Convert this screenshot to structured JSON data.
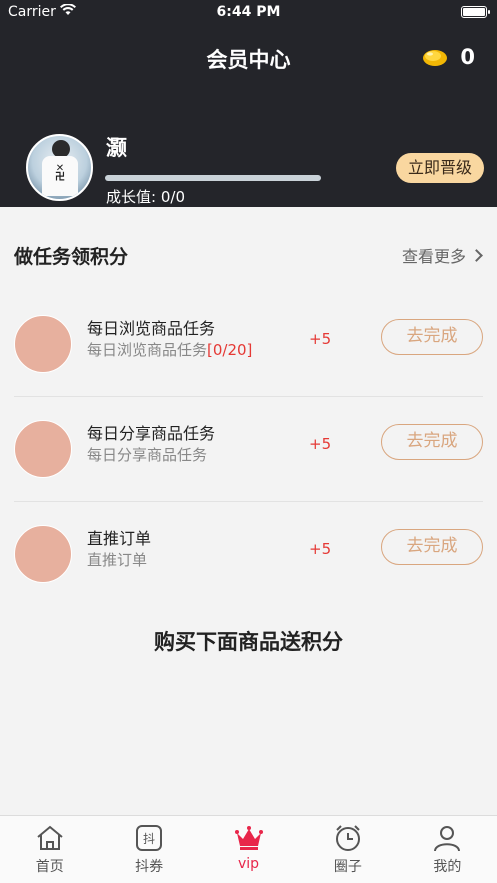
{
  "status_bar": {
    "carrier": "Carrier",
    "time": "6:44 PM"
  },
  "header": {
    "title": "会员中心",
    "coins": "0"
  },
  "profile": {
    "username": "灏",
    "growth_label": "成长值:",
    "growth_value": "0/0",
    "growth_progress": 0,
    "upgrade_label": "立即晋级"
  },
  "tasks_section": {
    "title": "做任务领积分",
    "more_label": "查看更多",
    "tasks": [
      {
        "name": "每日浏览商品任务",
        "sub": "每日浏览商品任务",
        "sub_highlight": "[0/20]",
        "points": "+5",
        "button": "去完成"
      },
      {
        "name": "每日分享商品任务",
        "sub": "每日分享商品任务",
        "points": "+5",
        "button": "去完成"
      },
      {
        "name": "直推订单",
        "sub": "直推订单",
        "points": "+5",
        "button": "去完成"
      }
    ]
  },
  "promo_title": "购买下面商品送积分",
  "tabbar": {
    "active_index": 2,
    "tabs": [
      {
        "label": "首页",
        "icon": "home-icon"
      },
      {
        "label": "抖券",
        "icon": "douquan-icon"
      },
      {
        "label": "vip",
        "icon": "crown-icon"
      },
      {
        "label": "圈子",
        "icon": "alarm-clock-icon"
      },
      {
        "label": "我的",
        "icon": "user-icon"
      }
    ]
  },
  "colors": {
    "header_bg": "#24252a",
    "accent_gold": "#f9d7a0",
    "accent_red": "#e53935",
    "vip_pink": "#e8264a",
    "button_outline": "#d9a67f"
  }
}
